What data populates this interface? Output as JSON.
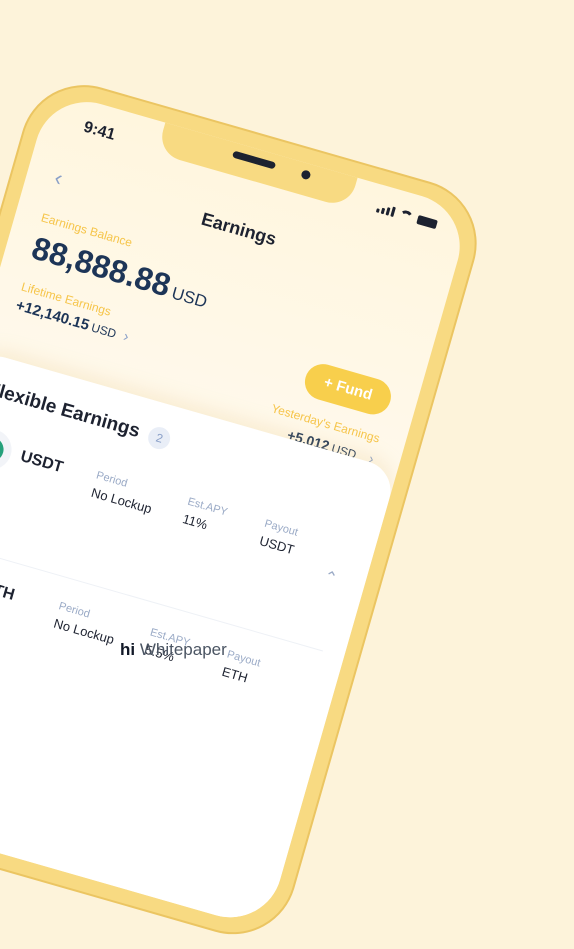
{
  "status": {
    "time": "9:41"
  },
  "header": {
    "title": "Earnings",
    "back_icon": "chevron-left-icon"
  },
  "balance": {
    "label": "Earnings Balance",
    "value": "88,888.88",
    "unit": "USD"
  },
  "lifetime": {
    "label": "Lifetime Earnings",
    "value": "+12,140.15",
    "unit": "USD"
  },
  "fund_button": {
    "label": "+ Fund"
  },
  "yesterday": {
    "label": "Yesterday's Earnings",
    "value": "+5,012",
    "unit": "USD"
  },
  "flexible": {
    "title": "Flexible Earnings",
    "count": "2",
    "assets": [
      {
        "name": "USDT",
        "period_label": "Period",
        "period": "No Lockup",
        "apy_label": "Est.APY",
        "apy": "11%",
        "payout_label": "Payout",
        "payout": "USDT"
      },
      {
        "name": "ETH",
        "period_label": "Period",
        "period": "No Lockup",
        "apy_label": "Est.APY",
        "apy": "5.5%",
        "payout_label": "Payout",
        "payout": "ETH"
      }
    ]
  },
  "footer": {
    "brand": "hi",
    "label": "Whitepaper"
  },
  "colors": {
    "accent": "#F8CF4C",
    "navy": "#1D3557",
    "label_yellow": "#F6C54A",
    "bg": "#FDF3DA"
  }
}
